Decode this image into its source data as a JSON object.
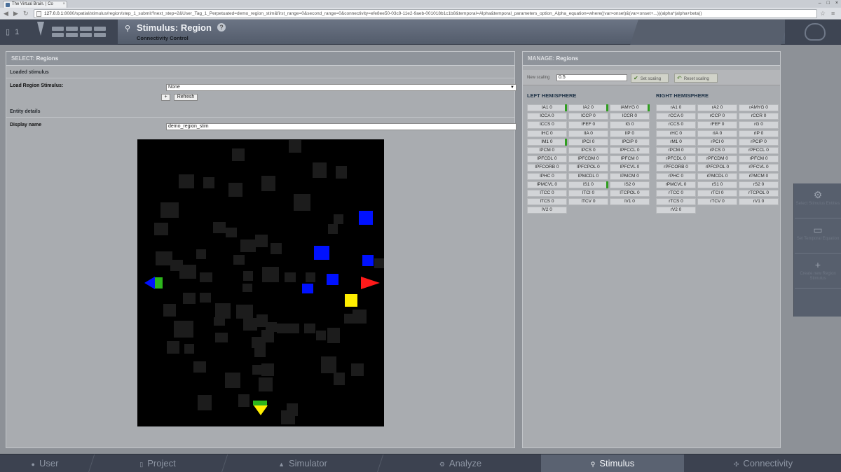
{
  "browser": {
    "tab_title": "The Virtual Brain. | Co",
    "url_host": "127.0.0.1",
    "url_rest": ":8080/spatial/stimulus/region/step_1_submit?next_step=2&User_Tag_1_Perpetuated=demo_region_stim&first_range=0&second_range=0&connectivity=efe8ee50-03c9-11e2-9aeb-001018b1c1b8&temporal=Alpha&temporal_parameters_option_Alpha_equation=where((var>onset)&(var<onset+...))(alpha*(alpha+beta))"
  },
  "header": {
    "user_indicator": "▯ 1",
    "title": "Stimulus: Region",
    "subtitle": "Connectivity Control",
    "help": "?"
  },
  "left": {
    "title_prefix": "SELECT:",
    "title": "Regions",
    "loaded_stimulus": "Loaded stimulus",
    "load_label": "Load Region Stimulus:",
    "select_value": "None",
    "plus_btn": "+",
    "refresh_btn": "Refresh",
    "entity_details": "Entity details",
    "display_name_label": "Display name",
    "display_name_value": "demo_region_stim"
  },
  "right": {
    "title_prefix": "MANAGE:",
    "title": "Regions",
    "scaling_label": "New scaling",
    "scaling_value": "0.5",
    "set_scaling": "Set scaling",
    "reset_scaling": "Reset scaling",
    "left_hemi": "LEFT HEMISPHERE",
    "right_hemi": "RIGHT HEMISPHERE",
    "left_regions": [
      {
        "label": "lA1 0",
        "on": true
      },
      {
        "label": "lA2 0",
        "on": true
      },
      {
        "label": "lAMYG 0",
        "on": true
      },
      {
        "label": "lCCA 0",
        "on": false
      },
      {
        "label": "lCCP 0",
        "on": false
      },
      {
        "label": "lCCR 0",
        "on": false
      },
      {
        "label": "lCCS 0",
        "on": false
      },
      {
        "label": "lFEF 0",
        "on": false
      },
      {
        "label": "lG 0",
        "on": false
      },
      {
        "label": "lHC 0",
        "on": false
      },
      {
        "label": "lIA 0",
        "on": false
      },
      {
        "label": "lIP 0",
        "on": false
      },
      {
        "label": "lM1 0",
        "on": true
      },
      {
        "label": "lPCI 0",
        "on": false
      },
      {
        "label": "lPCIP 0",
        "on": false
      },
      {
        "label": "lPCM 0",
        "on": false
      },
      {
        "label": "lPCS 0",
        "on": false
      },
      {
        "label": "lPFCCL 0",
        "on": false
      },
      {
        "label": "lPFCDL 0",
        "on": false
      },
      {
        "label": "lPFCDM 0",
        "on": false
      },
      {
        "label": "lPFCM 0",
        "on": false
      },
      {
        "label": "lPFCORB 0",
        "on": false
      },
      {
        "label": "lPFCPOL 0",
        "on": false
      },
      {
        "label": "lPFCVL 0",
        "on": false
      },
      {
        "label": "lPHC 0",
        "on": false
      },
      {
        "label": "lPMCDL 0",
        "on": false
      },
      {
        "label": "lPMCM 0",
        "on": false
      },
      {
        "label": "lPMCVL 0",
        "on": false
      },
      {
        "label": "lS1 0",
        "on": true
      },
      {
        "label": "lS2 0",
        "on": false
      },
      {
        "label": "lTCC 0",
        "on": false
      },
      {
        "label": "lTCI 0",
        "on": false
      },
      {
        "label": "lTCPOL 0",
        "on": false
      },
      {
        "label": "lTCS 0",
        "on": false
      },
      {
        "label": "lTCV 0",
        "on": false
      },
      {
        "label": "lV1 0",
        "on": false
      },
      {
        "label": "lV2 0",
        "on": false
      }
    ],
    "right_regions": [
      {
        "label": "rA1 0",
        "on": false
      },
      {
        "label": "rA2 0",
        "on": false
      },
      {
        "label": "rAMYG 0",
        "on": false
      },
      {
        "label": "rCCA 0",
        "on": false
      },
      {
        "label": "rCCP 0",
        "on": false
      },
      {
        "label": "rCCR 0",
        "on": false
      },
      {
        "label": "rCCS 0",
        "on": false
      },
      {
        "label": "rFEF 0",
        "on": false
      },
      {
        "label": "rG 0",
        "on": false
      },
      {
        "label": "rHC 0",
        "on": false
      },
      {
        "label": "rIA 0",
        "on": false
      },
      {
        "label": "rIP 0",
        "on": false
      },
      {
        "label": "rM1 0",
        "on": false
      },
      {
        "label": "rPCI 0",
        "on": false
      },
      {
        "label": "rPCIP 0",
        "on": false
      },
      {
        "label": "rPCM 0",
        "on": false
      },
      {
        "label": "rPCS 0",
        "on": false
      },
      {
        "label": "rPFCCL 0",
        "on": false
      },
      {
        "label": "rPFCDL 0",
        "on": false
      },
      {
        "label": "rPFCDM 0",
        "on": false
      },
      {
        "label": "rPFCM 0",
        "on": false
      },
      {
        "label": "rPFCORB 0",
        "on": false
      },
      {
        "label": "rPFCPOL 0",
        "on": false
      },
      {
        "label": "rPFCVL 0",
        "on": false
      },
      {
        "label": "rPHC 0",
        "on": false
      },
      {
        "label": "rPMCDL 0",
        "on": false
      },
      {
        "label": "rPMCM 0",
        "on": false
      },
      {
        "label": "rPMCVL 0",
        "on": false
      },
      {
        "label": "rS1 0",
        "on": false
      },
      {
        "label": "rS2 0",
        "on": false
      },
      {
        "label": "rTCC 0",
        "on": false
      },
      {
        "label": "rTCI 0",
        "on": false
      },
      {
        "label": "rTCPOL 0",
        "on": false
      },
      {
        "label": "rTCS 0",
        "on": false
      },
      {
        "label": "rTCV 0",
        "on": false
      },
      {
        "label": "rV1 0",
        "on": false
      },
      {
        "label": "rV2 0",
        "on": false
      }
    ]
  },
  "side_panel": [
    {
      "icon": "gear-icon",
      "label": "Select Stimulus Entities"
    },
    {
      "icon": "monitor-icon",
      "label": "Set Temporal Equation"
    },
    {
      "icon": "plus-icon",
      "label": "Create new Region Stimulus"
    }
  ],
  "footer": {
    "items": [
      "User",
      "Project",
      "Simulator",
      "Analyze",
      "Stimulus",
      "Connectivity"
    ],
    "active": "Stimulus"
  },
  "colors": {
    "accent_on": "#2f9e1f",
    "region_blue": "#0011ff",
    "region_yellow": "#ffee00",
    "region_red": "#ff1a1a",
    "region_green": "#2db51c"
  }
}
